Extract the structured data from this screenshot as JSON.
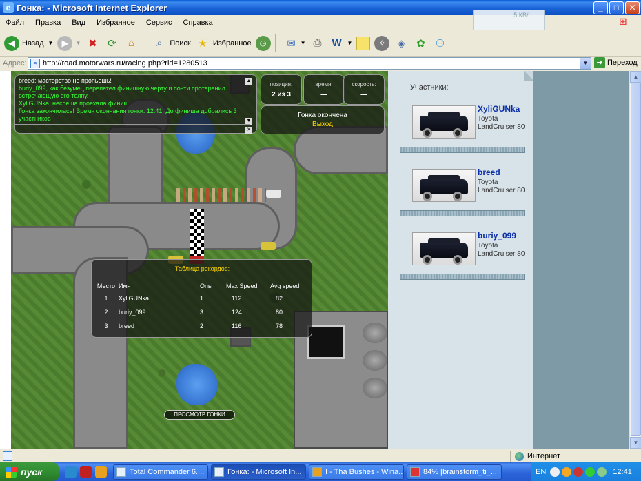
{
  "window": {
    "title": "Гонка: - Microsoft Internet Explorer",
    "minimize": "_",
    "maximize": "□",
    "close": "✕"
  },
  "menu": [
    "Файл",
    "Правка",
    "Вид",
    "Избранное",
    "Сервис",
    "Справка"
  ],
  "netbadge": "5 КВ/с",
  "toolbar": {
    "back": "Назад",
    "search": "Поиск",
    "favorites": "Избранное"
  },
  "address": {
    "label": "Адрес:",
    "url": "http://road.motorwars.ru/racing.php?rid=1280513",
    "go": "Переход"
  },
  "chat": {
    "lines": [
      {
        "text": "breed: мастерство не пропьешь!",
        "color": "white"
      },
      {
        "text": "buriy_099, как безумец перелетел финишную черту и почти протаранил встречающую его толпу.",
        "color": "green"
      },
      {
        "text": "XyliGUNka, неспеша проехала финиш.",
        "color": "green"
      },
      {
        "text": "Гонка закончилась! Время окончания гонки: 12:41. До финиша добрались 3 участников",
        "color": "green"
      }
    ]
  },
  "stats": {
    "position_label": "позиция:",
    "position_value": "2 из 3",
    "time_label": "время:",
    "time_value": "---",
    "speed_label": "скорость:",
    "speed_value": "---"
  },
  "race": {
    "status": "Гонка окончена",
    "exit": "Выход"
  },
  "records": {
    "title": "Таблица рекордов:",
    "headers": [
      "Место",
      "Имя",
      "Опыт",
      "Max Speed",
      "Avg speed"
    ],
    "rows": [
      [
        "1",
        "XyliGUNka",
        "1",
        "112",
        "82"
      ],
      [
        "2",
        "buriy_099",
        "3",
        "124",
        "80"
      ],
      [
        "3",
        "breed",
        "2",
        "116",
        "78"
      ]
    ]
  },
  "view_race_button": "ПРОСМОТР ГОНКИ",
  "participants": {
    "title": "Участники:",
    "players": [
      {
        "name": "XyliGUNka",
        "car": "Toyota LandCruiser 80"
      },
      {
        "name": "breed",
        "car": "Toyota LandCruiser 80"
      },
      {
        "name": "buriy_099",
        "car": "Toyota LandCruiser 80"
      }
    ]
  },
  "status": {
    "zone": "Интернет"
  },
  "taskbar": {
    "start": "пуск",
    "tasks": [
      {
        "label": "Total Commander 6....",
        "active": false
      },
      {
        "label": "Гонка: - Microsoft In...",
        "active": true
      },
      {
        "label": "I - Tha Bushes - Wina...",
        "active": false
      },
      {
        "label": "84% [brainstorm_ti_...",
        "active": false
      }
    ],
    "lang": "EN",
    "clock": "12:41"
  }
}
